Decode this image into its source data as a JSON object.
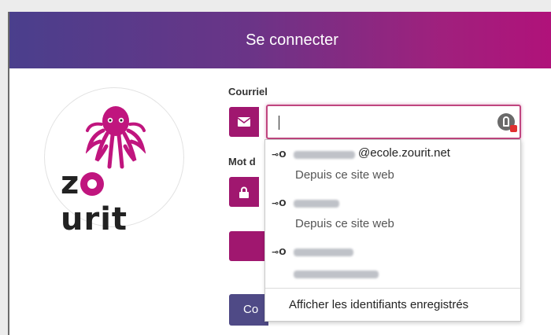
{
  "titlebar": {
    "title": "Se connecter"
  },
  "logo": {
    "brand_text_1": "z",
    "brand_text_2": "urit",
    "brand_accent_color": "#c0157e"
  },
  "form": {
    "email_label": "Courriel",
    "password_label": "Mot d",
    "email_value": "",
    "connect_label": "Co"
  },
  "autocomplete": {
    "entries": [
      {
        "domain_suffix": "@ecole.zourit.net",
        "source": "Depuis ce site web"
      },
      {
        "domain_suffix": "",
        "source": "Depuis ce site web"
      },
      {
        "domain_suffix": "",
        "source": ""
      }
    ],
    "footer": "Afficher les identifiants enregistrés"
  },
  "colors": {
    "accent": "#a0176f",
    "header_start": "#4a3f8c",
    "header_end": "#b0127a",
    "button": "#4f4a86"
  }
}
